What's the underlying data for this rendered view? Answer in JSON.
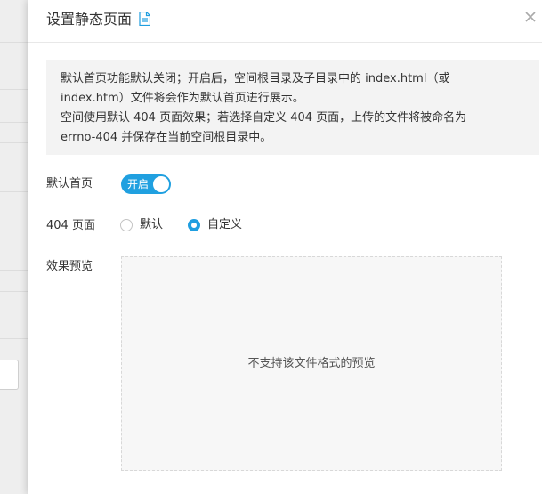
{
  "drawer": {
    "title": "设置静态页面",
    "info": {
      "line1": "默认首页功能默认关闭；开启后，空间根目录及子目录中的 index.html（或",
      "line2": "index.htm）文件将会作为默认首页进行展示。",
      "line3": "空间使用默认 404 页面效果；若选择自定义 404 页面，上传的文件将被命名为",
      "line4": "errno-404 并保存在当前空间根目录中。"
    },
    "default_homepage": {
      "label": "默认首页",
      "toggle_text": "开启",
      "enabled": true
    },
    "page_404": {
      "label": "404 页面",
      "options": [
        {
          "label": "默认",
          "selected": false
        },
        {
          "label": "自定义",
          "selected": true
        }
      ]
    },
    "preview": {
      "label": "效果预览",
      "message": "不支持该文件格式的预览"
    }
  },
  "colors": {
    "accent": "#1f9ee0",
    "info_bg": "#f3f3f3",
    "preview_bg": "#f7f7f7",
    "text": "#333333"
  },
  "icons": {
    "title_icon": "document-icon",
    "close": "close-icon"
  }
}
